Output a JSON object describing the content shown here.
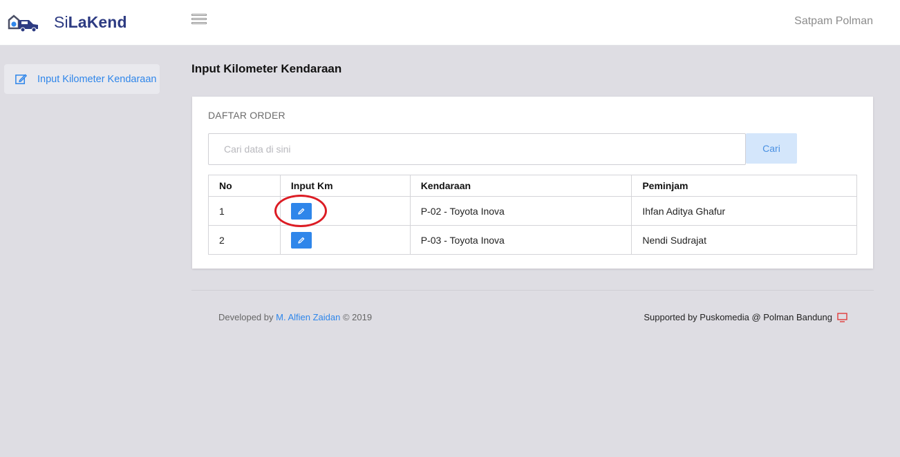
{
  "header": {
    "brand_prefix": "Si",
    "brand_suffix": "LaKend",
    "user_name": "Satpam Polman"
  },
  "sidebar": {
    "items": [
      {
        "label": "Input Kilometer Kendaraan",
        "icon": "edit-icon"
      }
    ]
  },
  "main": {
    "page_title": "Input Kilometer Kendaraan",
    "card": {
      "title": "DAFTAR ORDER",
      "search": {
        "placeholder": "Cari data di sini",
        "value": "",
        "button_label": "Cari"
      },
      "table": {
        "headers": [
          "No",
          "Input Km",
          "Kendaraan",
          "Peminjam"
        ],
        "rows": [
          {
            "no": "1",
            "kendaraan": "P-02 - Toyota Inova",
            "peminjam": "Ihfan Aditya Ghafur"
          },
          {
            "no": "2",
            "kendaraan": "P-03 - Toyota Inova",
            "peminjam": "Nendi Sudrajat"
          }
        ]
      }
    }
  },
  "footer": {
    "developed_prefix": "Developed by ",
    "developer_name": "M. Alfien Zaidan",
    "developed_suffix": " © 2019",
    "supported_text": "Supported by Puskomedia @ Polman Bandung"
  },
  "colors": {
    "brand": "#2d3b82",
    "accent": "#2f86ea",
    "highlight": "#dc1c24"
  }
}
